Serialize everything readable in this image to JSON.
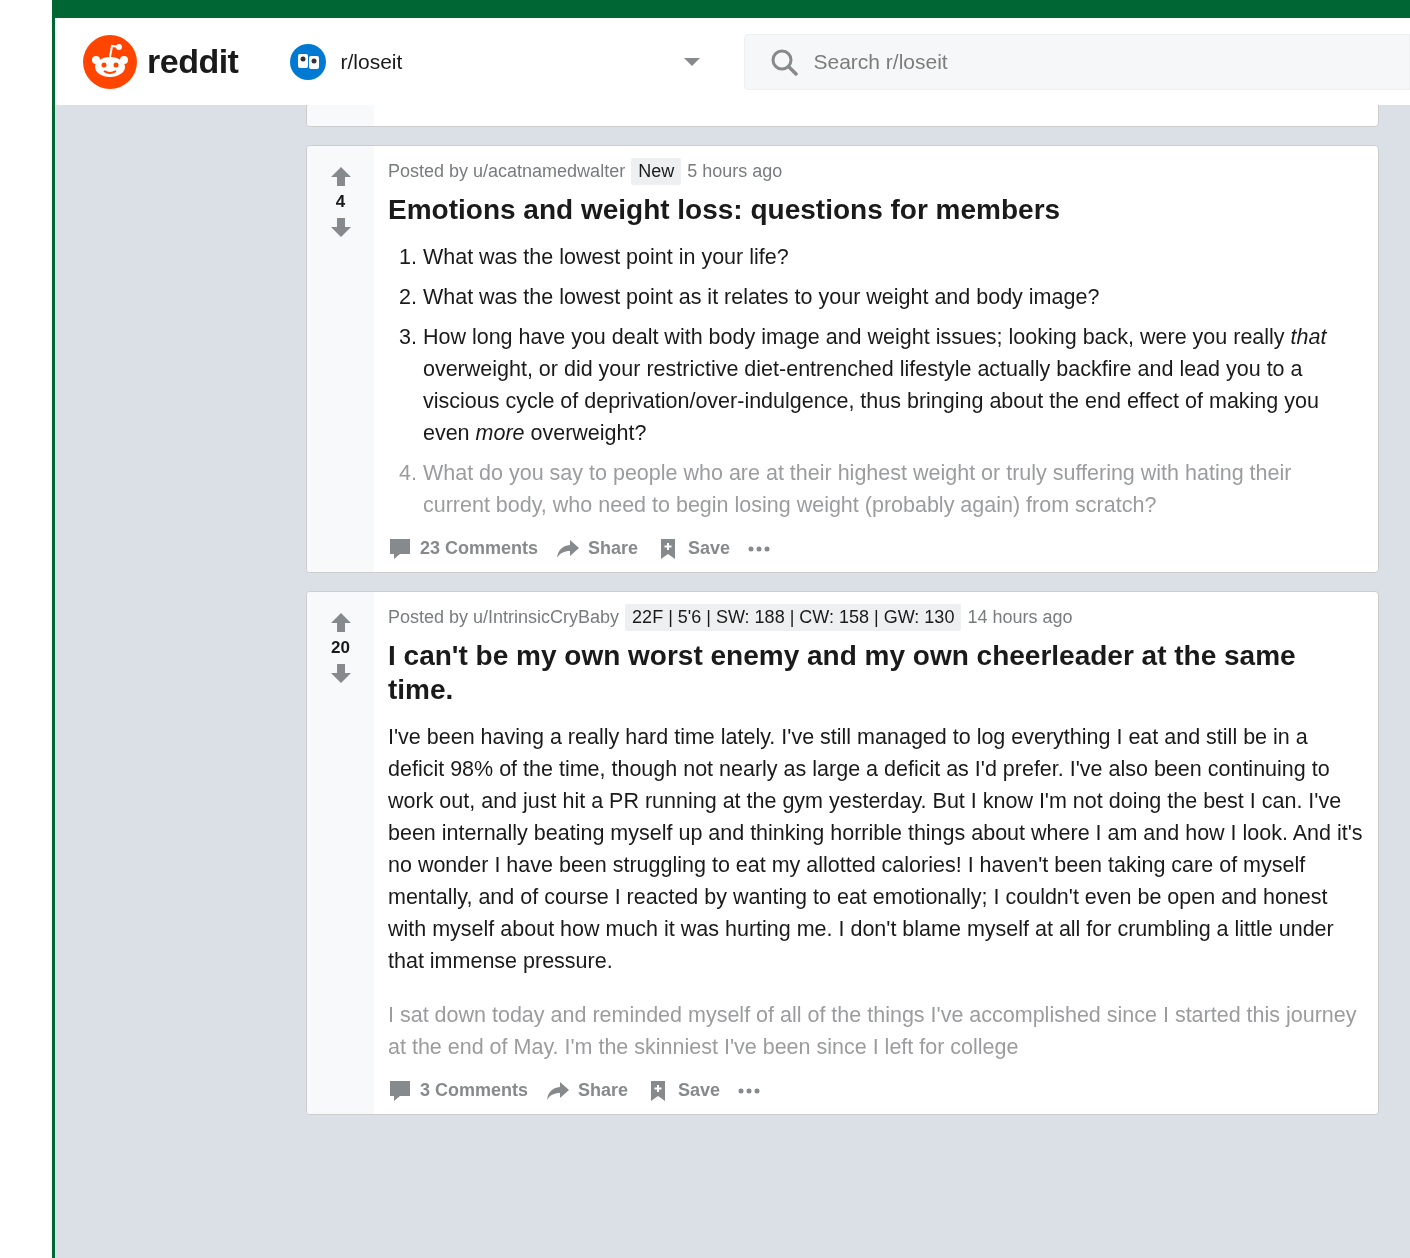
{
  "header": {
    "logo_text": "reddit",
    "subreddit": "r/loseit",
    "search": {
      "placeholder": "Search r/loseit"
    }
  },
  "posts": [
    {
      "votes": "4",
      "byline": "Posted by u/acatnamedwalter",
      "flair": "New",
      "time": "5 hours ago",
      "title": "Emotions and weight loss: questions for members",
      "body": {
        "kind": "list",
        "items": [
          {
            "marker": "1.",
            "text": "What was the lowest point in your life?",
            "faded": false
          },
          {
            "marker": "2.",
            "text": "What was the lowest point as it relates to your weight and body image?",
            "faded": false
          },
          {
            "marker": "3.",
            "text": "How long have you dealt with body image and weight issues; looking back, were you really *that* overweight, or did your restrictive diet-entrenched lifestyle actually backfire and lead you to a viscious cycle of deprivation/over-indulgence, thus bringing about the end effect of making you even *more* overweight?",
            "faded": false
          },
          {
            "marker": "4.",
            "text": "What do you say to people who are at their highest weight or truly suffering with hating their current body, who need to begin losing weight (probably again) from scratch?",
            "faded": true
          }
        ]
      },
      "actions": {
        "comments": "23 Comments",
        "share": "Share",
        "save": "Save"
      }
    },
    {
      "votes": "20",
      "byline": "Posted by u/IntrinsicCryBaby",
      "flair": "22F | 5'6 | SW: 188 | CW: 158 | GW: 130",
      "time": "14 hours ago",
      "title": "I can't be my own worst enemy and my own cheerleader at the same time.",
      "body": {
        "kind": "paragraphs",
        "items": [
          {
            "text": "I've been having a really hard time lately. I've still managed to log everything I eat and still be in a deficit 98% of the time, though not nearly as large a deficit as I'd prefer. I've also been continuing to work out, and just hit a PR running at the gym yesterday. But I know I'm not doing the best I can. I've been internally beating myself up and thinking horrible things about where I am and how I look. And it's no wonder I have been struggling to eat my allotted calories! I haven't been taking care of myself mentally, and of course I reacted by wanting to eat emotionally; I couldn't even be open and honest with myself about how much it was hurting me. I don't blame myself at all for crumbling a little under that immense pressure.",
            "faded": false
          },
          {
            "text": "I sat down today and reminded myself of all of the things I've accomplished since I started this journey at the end of May. I'm the skinniest I've been since I left for college",
            "faded": true
          }
        ]
      },
      "actions": {
        "comments": "3 Comments",
        "share": "Share",
        "save": "Save"
      }
    }
  ]
}
